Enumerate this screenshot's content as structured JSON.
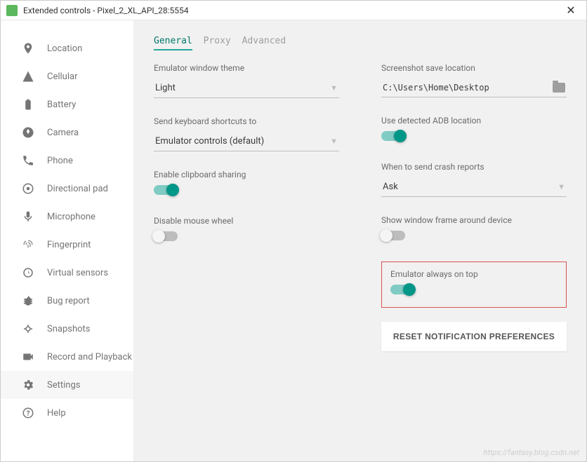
{
  "window": {
    "title": "Extended controls - Pixel_2_XL_API_28:5554"
  },
  "sidebar": {
    "items": [
      {
        "label": "Location"
      },
      {
        "label": "Cellular"
      },
      {
        "label": "Battery"
      },
      {
        "label": "Camera"
      },
      {
        "label": "Phone"
      },
      {
        "label": "Directional pad"
      },
      {
        "label": "Microphone"
      },
      {
        "label": "Fingerprint"
      },
      {
        "label": "Virtual sensors"
      },
      {
        "label": "Bug report"
      },
      {
        "label": "Snapshots"
      },
      {
        "label": "Record and Playback"
      },
      {
        "label": "Settings"
      },
      {
        "label": "Help"
      }
    ]
  },
  "tabs": {
    "general": "General",
    "proxy": "Proxy",
    "advanced": "Advanced"
  },
  "settings": {
    "theme_label": "Emulator window theme",
    "theme_value": "Light",
    "shortcuts_label": "Send keyboard shortcuts to",
    "shortcuts_value": "Emulator controls (default)",
    "clipboard_label": "Enable clipboard sharing",
    "mousewheel_label": "Disable mouse wheel",
    "screenshot_label": "Screenshot save location",
    "screenshot_path": "C:\\Users\\Home\\Desktop",
    "adb_label": "Use detected ADB location",
    "crash_label": "When to send crash reports",
    "crash_value": "Ask",
    "frame_label": "Show window frame around device",
    "ontop_label": "Emulator always on top",
    "reset_label": "RESET NOTIFICATION PREFERENCES"
  },
  "watermark": "https://fantasy.blog.csdn.net"
}
